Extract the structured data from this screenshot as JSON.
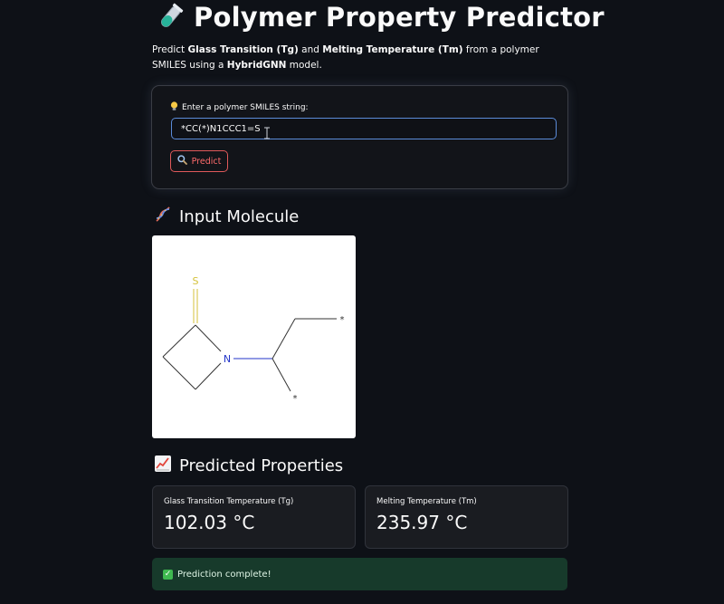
{
  "header": {
    "title": "Polymer Property Predictor",
    "title_icon": "test-tube-icon"
  },
  "intro": {
    "prefix": "Predict ",
    "tg_bold": "Glass Transition (Tg)",
    "and": " and ",
    "tm_bold": "Melting Temperature (Tm)",
    "middle": " from a polymer SMILES using a ",
    "model_bold": "HybridGNN",
    "suffix": " model."
  },
  "form": {
    "label": "Enter a polymer SMILES string:",
    "label_icon": "lightbulb-icon",
    "smiles_value": "*CC(*)N1CCC1=S",
    "predict_label": "Predict",
    "predict_icon": "magnifier-icon"
  },
  "molecule_section": {
    "heading": "Input Molecule",
    "heading_icon": "dna-icon",
    "atoms": {
      "sulfur": "S",
      "nitrogen": "N",
      "star_top": "*",
      "star_bottom": "*"
    }
  },
  "predicted_section": {
    "heading": "Predicted Properties",
    "heading_icon": "chart-increasing-icon",
    "metrics": [
      {
        "label": "Glass Transition Temperature (Tg)",
        "value": "102.03 °C"
      },
      {
        "label": "Melting Temperature (Tm)",
        "value": "235.97 °C"
      }
    ]
  },
  "status": {
    "message": "Prediction complete!",
    "icon": "check-mark-icon"
  },
  "colors": {
    "background": "#0e1117",
    "accent_red": "#ff6b6b",
    "input_border": "#5b8bd8",
    "success_bg": "#173a2b",
    "success_check": "#3fb950",
    "sulfur": "#d4c23a",
    "nitrogen": "#2335c9"
  }
}
